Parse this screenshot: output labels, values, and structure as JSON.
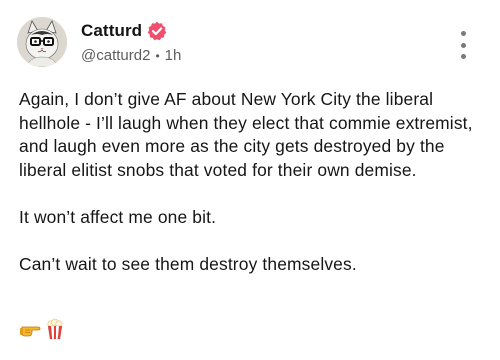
{
  "post": {
    "display_name": "Catturd",
    "handle": "@catturd2",
    "separator": "•",
    "time_ago": "1h",
    "paragraphs": [
      "Again, I don’t give AF about New York City the liberal hellhole - I’ll laugh when they elect that commie extremist, and laugh even more as the city gets destroyed by the liberal elitist snobs that voted for their own demise.",
      "It won’t affect me one bit.",
      "Can’t wait to see them destroy themselves."
    ],
    "emojis": [
      "pointing-hand-icon",
      "popcorn-icon"
    ]
  },
  "colors": {
    "verified_badge": "#f0506e",
    "text": "#161616",
    "muted": "#5e5e5e",
    "popcorn_red": "#e2403a",
    "hand_yellow": "#f5b82e"
  }
}
